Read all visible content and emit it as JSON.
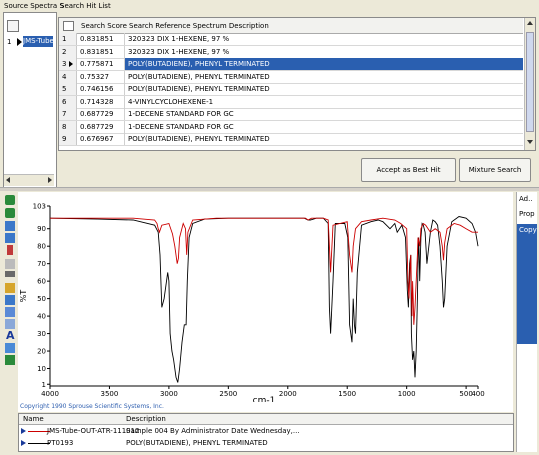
{
  "top_tabs": {
    "source": "Source Spectra S",
    "hit_list": "Search Hit List"
  },
  "source_list": {
    "row_index": "1",
    "row_label": "JMS-Tube"
  },
  "hit_table": {
    "headers": {
      "score": "Search Score",
      "description": "Search Reference Spectrum Description"
    },
    "rows": [
      {
        "n": "1",
        "score": "0.831851",
        "desc": "320323 DIX 1-HEXENE, 97 %"
      },
      {
        "n": "2",
        "score": "0.831851",
        "desc": "320323 DIX 1-HEXENE, 97 %"
      },
      {
        "n": "3",
        "score": "0.775871",
        "desc": "POLY(BUTADIENE), PHENYL TERMINATED",
        "selected": true
      },
      {
        "n": "4",
        "score": "0.75327",
        "desc": "POLY(BUTADIENE), PHENYL TERMINATED"
      },
      {
        "n": "5",
        "score": "0.746156",
        "desc": "POLY(BUTADIENE), PHENYL TERMINATED"
      },
      {
        "n": "6",
        "score": "0.714328",
        "desc": "4-VINYLCYCLOHEXENE-1"
      },
      {
        "n": "7",
        "score": "0.687729",
        "desc": "1-DECENE STANDARD FOR GC"
      },
      {
        "n": "8",
        "score": "0.687729",
        "desc": "1-DECENE STANDARD FOR GC"
      },
      {
        "n": "9",
        "score": "0.676967",
        "desc": "POLY(BUTADIENE), PHENYL TERMINATED"
      }
    ]
  },
  "buttons": {
    "accept": "Accept as Best Hit",
    "mixture": "Mixture Search"
  },
  "right_tabs": {
    "a": "Ad..",
    "b": "Prop",
    "c": "Copy"
  },
  "copyright": "Copyright 1990 Sprouse Scientific Systems, Inc.",
  "legend": {
    "headers": {
      "name": "Name",
      "description": "Description"
    },
    "rows": [
      {
        "name": "JMS-Tube-OUT-ATR-111012",
        "description": "Sample 004 By Administrator Date Wednesday,...",
        "color": "#cc0000"
      },
      {
        "name": "PT0193",
        "description": "POLY(BUTADIENE), PHENYL TERMINATED",
        "color": "#000000"
      }
    ]
  },
  "chart_data": {
    "type": "line",
    "xlabel": "cm-1",
    "ylabel": "%T",
    "xlim": [
      4000,
      400
    ],
    "ylim": [
      0,
      103
    ],
    "x_ticks": [
      "4000",
      "3500",
      "3000",
      "2500",
      "2000",
      "1500",
      "1000",
      "500",
      "400"
    ],
    "y_ticks": [
      "103",
      "90",
      "80",
      "70",
      "60",
      "50",
      "40",
      "30",
      "20",
      "10",
      "1"
    ],
    "series": [
      {
        "color": "#000000",
        "x": [
          4000,
          3600,
          3300,
          3120,
          3090,
          3075,
          3060,
          3040,
          3010,
          3000,
          2990,
          2975,
          2960,
          2940,
          2925,
          2910,
          2890,
          2870,
          2855,
          2845,
          2830,
          2800,
          2700,
          2500,
          2300,
          2100,
          1950,
          1860,
          1830,
          1810,
          1760,
          1700,
          1660,
          1650,
          1640,
          1620,
          1600,
          1520,
          1495,
          1480,
          1460,
          1450,
          1440,
          1430,
          1415,
          1380,
          1300,
          1240,
          1200,
          1140,
          1100,
          1080,
          1040,
          1010,
          995,
          985,
          975,
          965,
          960,
          950,
          940,
          930,
          920,
          910,
          905,
          900,
          895,
          890,
          880,
          870,
          860,
          845,
          830,
          800,
          780,
          760,
          740,
          720,
          700,
          690,
          680,
          660,
          620,
          560,
          500,
          450,
          420,
          400
        ],
        "y": [
          96,
          95.5,
          95,
          92,
          88,
          75,
          45,
          50,
          65,
          60,
          30,
          20,
          15,
          5,
          2,
          10,
          25,
          35,
          35,
          60,
          85,
          93,
          95.5,
          96,
          96,
          96,
          96,
          96,
          95,
          95,
          96,
          96,
          93,
          45,
          30,
          60,
          93,
          93,
          85,
          35,
          25,
          50,
          35,
          30,
          65,
          92,
          94,
          95,
          94,
          90,
          93,
          88,
          92,
          85,
          55,
          45,
          70,
          75,
          30,
          15,
          20,
          5,
          20,
          50,
          70,
          85,
          75,
          60,
          85,
          93,
          92,
          88,
          70,
          88,
          95,
          94,
          92,
          80,
          60,
          45,
          50,
          80,
          94,
          97,
          96,
          93,
          88,
          80
        ]
      },
      {
        "color": "#cc0000",
        "x": [
          4000,
          3600,
          3300,
          3120,
          3100,
          3090,
          3080,
          3060,
          3000,
          2970,
          2950,
          2930,
          2920,
          2910,
          2880,
          2860,
          2850,
          2840,
          2800,
          2600,
          2400,
          2200,
          2000,
          1850,
          1830,
          1800,
          1700,
          1660,
          1650,
          1640,
          1620,
          1500,
          1480,
          1460,
          1450,
          1430,
          1380,
          1300,
          1200,
          1100,
          1050,
          1000,
          990,
          980,
          970,
          965,
          960,
          955,
          950,
          945,
          940,
          930,
          910,
          905,
          890,
          880,
          860,
          840,
          800,
          760,
          720,
          700,
          690,
          680,
          660,
          600,
          550,
          500,
          450,
          400
        ],
        "y": [
          96,
          96,
          96,
          95,
          93,
          90,
          88,
          92,
          93,
          87,
          80,
          70,
          73,
          85,
          93,
          90,
          75,
          88,
          95,
          96,
          96,
          96,
          96,
          96,
          95,
          96,
          96,
          95,
          80,
          65,
          92,
          94,
          75,
          65,
          80,
          90,
          94,
          95,
          96,
          95,
          93,
          90,
          60,
          50,
          70,
          75,
          55,
          40,
          60,
          50,
          35,
          45,
          75,
          85,
          80,
          90,
          93,
          92,
          88,
          90,
          88,
          80,
          72,
          82,
          90,
          93,
          92,
          90,
          88,
          88
        ]
      }
    ]
  }
}
